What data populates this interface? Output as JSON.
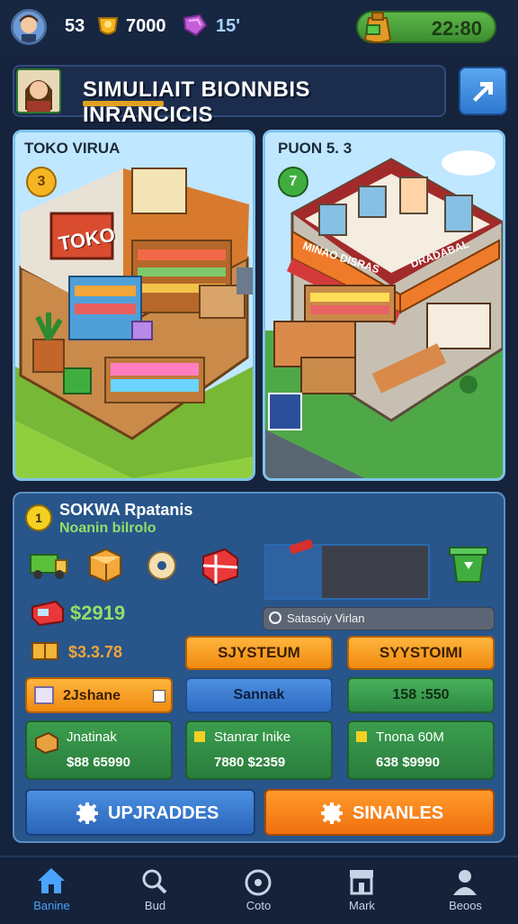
{
  "top_bar": {
    "level": "53",
    "coins": "7000",
    "gems": "15'",
    "time": "22:80"
  },
  "banner": {
    "title": "SIMULIAIT BIONNBIS INRANCICIS"
  },
  "scenes": [
    {
      "title": "TOKO VIRUA",
      "level": "3",
      "sign": "TOKO"
    },
    {
      "title": "PUON 5. 3",
      "level": "7",
      "sign_left": "MINAO DISRAS",
      "sign_right": "DRADABAL"
    }
  ],
  "panel": {
    "title": "SOKWA Rpatanis",
    "subtitle": "Noanin bilrolo",
    "level": "1",
    "money": "$2919",
    "search_placeholder": "Satasoiy Virlan",
    "price": "$3.3.78",
    "btn_system_1": "SJYSTEUM",
    "btn_system_2": "SYYSTOIMI",
    "option_1": "2Jshane",
    "option_2": "Sannak",
    "option_3": "158 :550",
    "card_1": {
      "title": "Jnatinak",
      "value": "$88 65990"
    },
    "card_2": {
      "title": "Stanrar Inike",
      "value": "7880 $2359"
    },
    "card_3": {
      "title": "Tnona 60M",
      "value": "638 $9990"
    }
  },
  "actions": {
    "upgrades": "UPJRADDES",
    "sinanles": "SINANLES"
  },
  "nav": [
    {
      "label": "Banine",
      "icon": "home-icon",
      "active": true
    },
    {
      "label": "Bud",
      "icon": "search-icon",
      "active": false
    },
    {
      "label": "Coto",
      "icon": "target-icon",
      "active": false
    },
    {
      "label": "Mark",
      "icon": "store-icon",
      "active": false
    },
    {
      "label": "Beoos",
      "icon": "profile-icon",
      "active": false
    }
  ],
  "colors": {
    "background": "#16233d",
    "panel": "#28558a",
    "accent_orange": "#f08a10",
    "accent_blue": "#2e6cc4",
    "accent_green": "#2d8a41"
  }
}
